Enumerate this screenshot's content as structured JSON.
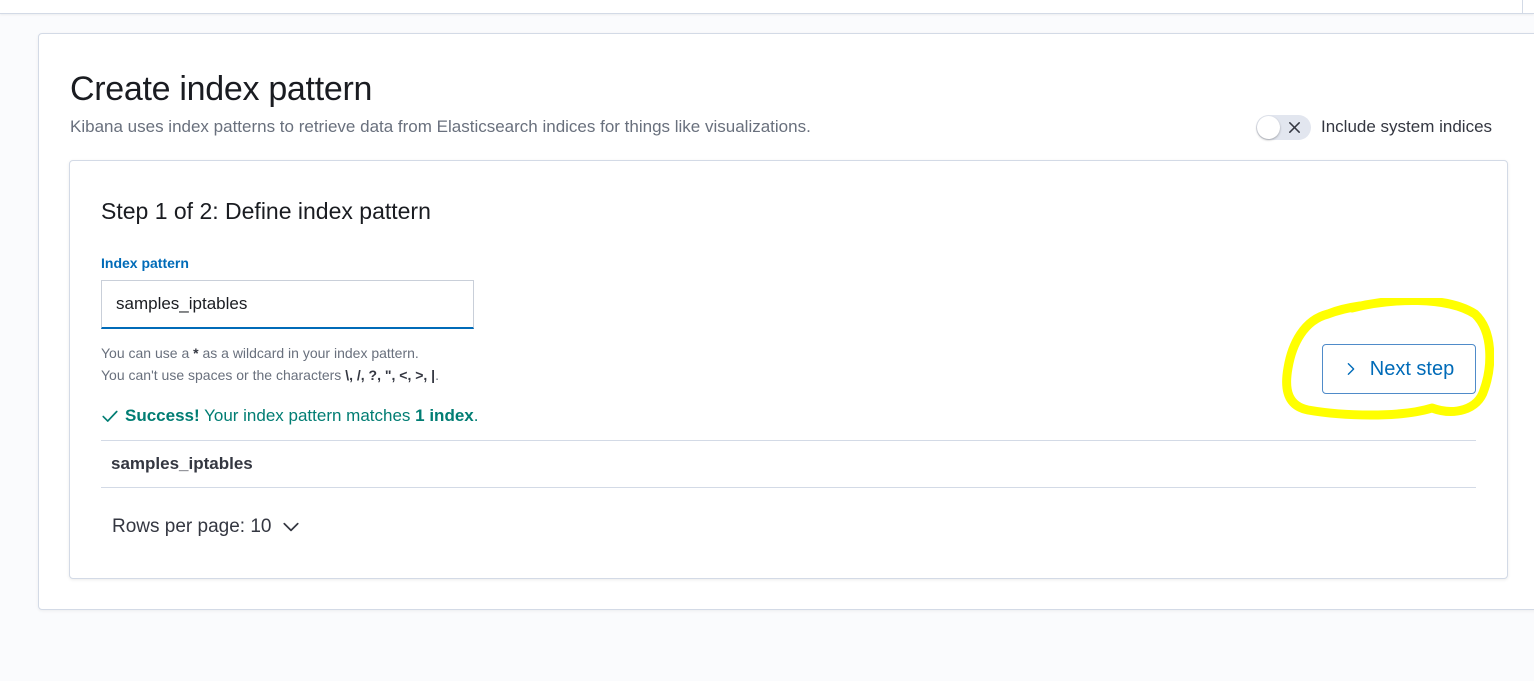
{
  "header": {
    "title": "Create index pattern",
    "subtitle": "Kibana uses index patterns to retrieve data from Elasticsearch indices for things like visualizations."
  },
  "system_indices_toggle": {
    "label": "Include system indices",
    "checked": false,
    "icon": "close-icon"
  },
  "step": {
    "title": "Step 1 of 2: Define index pattern",
    "field_label": "Index pattern",
    "input_value": "samples_iptables",
    "help_line1_pre": "You can use a ",
    "help_line1_wildcard": "*",
    "help_line1_post": " as a wildcard in your index pattern.",
    "help_line2_pre": "You can't use spaces or the characters ",
    "help_line2_chars": "\\, /, ?, \", <, >, |",
    "help_line2_post": "."
  },
  "next_button": {
    "label": "Next step",
    "icon": "chevron-right-icon"
  },
  "success": {
    "icon": "check-icon",
    "strong": "Success!",
    "text": " Your index pattern matches ",
    "count": "1 index",
    "end": "."
  },
  "results": {
    "rows": [
      "samples_iptables"
    ]
  },
  "pagination": {
    "label": "Rows per page: 10",
    "icon": "chevron-down-icon"
  },
  "colors": {
    "primary": "#006bb8",
    "success": "#017d73",
    "annotation": "#ffff00"
  }
}
